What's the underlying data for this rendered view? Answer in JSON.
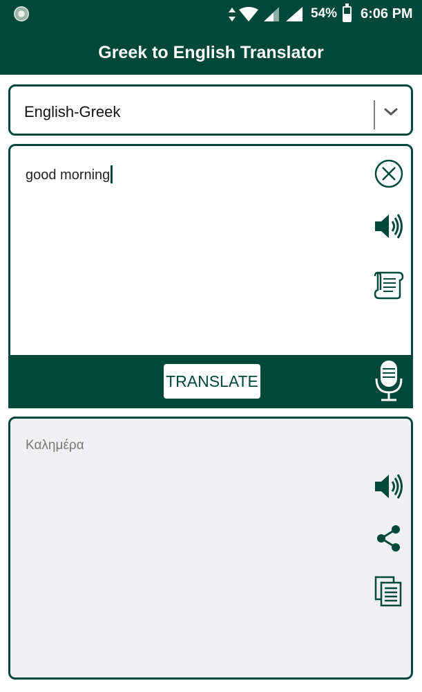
{
  "status_bar": {
    "battery": "54%",
    "time": "6:06 PM"
  },
  "header": {
    "title": "Greek to English Translator"
  },
  "language_selector": {
    "selected": "English-Greek"
  },
  "input": {
    "text": "good morning",
    "translate_label": "TRANSLATE"
  },
  "output": {
    "text": "Καλημέρα"
  },
  "icons": {
    "clear": "close-circle-icon",
    "speak_input": "speaker-icon",
    "history": "scroll-icon",
    "mic": "microphone-icon",
    "speak_output": "speaker-icon",
    "share": "share-icon",
    "copy": "copy-icon"
  },
  "colors": {
    "primary": "#00493a",
    "output_background": "#f0f0f2"
  }
}
